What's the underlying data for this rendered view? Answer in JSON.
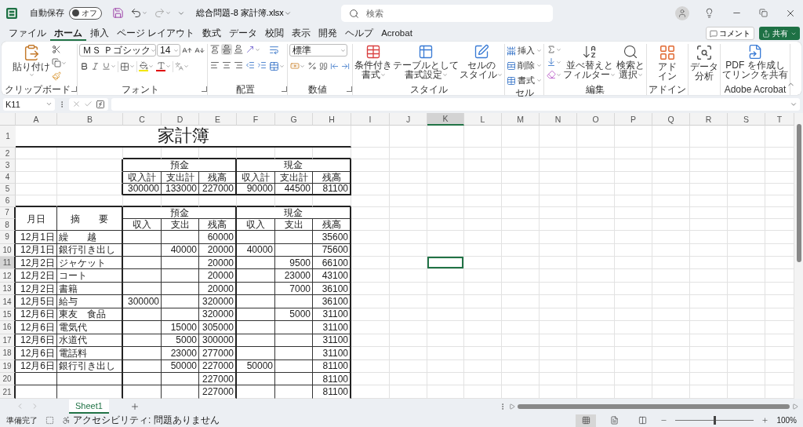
{
  "title_bar": {
    "autosave": {
      "label": "自動保存",
      "on": false,
      "state": "オフ"
    },
    "file_name": "総合問題-8 家計簿.xlsx",
    "search": {
      "placeholder": "検索"
    }
  },
  "menu": {
    "tabs": [
      {
        "label": "ファイル",
        "selected": false
      },
      {
        "label": "ホーム",
        "selected": true
      },
      {
        "label": "挿入",
        "selected": false
      },
      {
        "label": "ページ レイアウト",
        "selected": false
      },
      {
        "label": "数式",
        "selected": false
      },
      {
        "label": "データ",
        "selected": false
      },
      {
        "label": "校閲",
        "selected": false
      },
      {
        "label": "表示",
        "selected": false
      },
      {
        "label": "開発",
        "selected": false
      },
      {
        "label": "ヘルプ",
        "selected": false
      },
      {
        "label": "Acrobat",
        "selected": false
      }
    ],
    "comment_button": "コメント",
    "share_button": "共有"
  },
  "ribbon": {
    "groups": [
      {
        "kind": "clipboard",
        "label": "クリップボード",
        "buttons": [
          {
            "lines": [
              "貼り付け"
            ]
          }
        ]
      },
      {
        "kind": "font",
        "label": "フォント",
        "font_name": "ＭＳ Ｐゴシック",
        "font_size": "14"
      },
      {
        "kind": "alignment",
        "label": "配置",
        "vertical": [
          {
            "selected": false
          },
          {
            "selected": true
          },
          {
            "selected": false
          }
        ]
      },
      {
        "kind": "number",
        "label": "数値",
        "format": "標準"
      },
      {
        "kind": "styles",
        "label": "スタイル",
        "buttons": [
          {
            "lines": [
              "条件付き",
              "書式"
            ]
          },
          {
            "lines": [
              "テーブルとして",
              "書式設定"
            ]
          },
          {
            "lines": [
              "セルの",
              "スタイル"
            ]
          }
        ]
      },
      {
        "kind": "cells",
        "label": "セル",
        "buttons": [
          {
            "lines": [
              "挿入"
            ]
          },
          {
            "lines": [
              "削除"
            ]
          },
          {
            "lines": [
              "書式"
            ]
          }
        ]
      },
      {
        "kind": "editing",
        "label": "編集",
        "buttons": [
          {
            "lines": [
              "並べ替えと",
              "フィルター"
            ]
          },
          {
            "lines": [
              "検索と",
              "選択"
            ]
          }
        ]
      },
      {
        "kind": "addins",
        "label": "アドイン",
        "buttons": [
          {
            "lines": [
              "アド",
              "イン"
            ]
          }
        ]
      },
      {
        "kind": "analysis",
        "buttons": [
          {
            "lines": [
              "データ",
              "分析"
            ]
          }
        ]
      },
      {
        "kind": "acrobat",
        "label": "Adobe Acrobat",
        "buttons": [
          {
            "lines": [
              "PDF を作成し",
              "てリンクを共有"
            ]
          }
        ]
      }
    ]
  },
  "formula_bar": {
    "name_box": "K11"
  },
  "sheet": {
    "columns": [
      {
        "label": "A",
        "selected": false
      },
      {
        "label": "B",
        "selected": false
      },
      {
        "label": "C",
        "selected": false
      },
      {
        "label": "D",
        "selected": false
      },
      {
        "label": "E",
        "selected": false
      },
      {
        "label": "F",
        "selected": false
      },
      {
        "label": "G",
        "selected": false
      },
      {
        "label": "H",
        "selected": false
      },
      {
        "label": "I",
        "selected": false
      },
      {
        "label": "J",
        "selected": false
      },
      {
        "label": "K",
        "selected": true
      },
      {
        "label": "L",
        "selected": false
      },
      {
        "label": "M",
        "selected": false
      },
      {
        "label": "N",
        "selected": false
      },
      {
        "label": "O",
        "selected": false
      },
      {
        "label": "P",
        "selected": false
      },
      {
        "label": "Q",
        "selected": false
      },
      {
        "label": "R",
        "selected": false
      },
      {
        "label": "S",
        "selected": false
      },
      {
        "label": "T",
        "selected": false
      }
    ],
    "rows": [
      {
        "label": "1",
        "selected": false
      },
      {
        "label": "2",
        "selected": false
      },
      {
        "label": "3",
        "selected": false
      },
      {
        "label": "4",
        "selected": false
      },
      {
        "label": "5",
        "selected": false
      },
      {
        "label": "6",
        "selected": false
      },
      {
        "label": "7",
        "selected": false
      },
      {
        "label": "8",
        "selected": false
      },
      {
        "label": "9",
        "selected": false
      },
      {
        "label": "10",
        "selected": false
      },
      {
        "label": "11",
        "selected": true
      },
      {
        "label": "12",
        "selected": false
      },
      {
        "label": "13",
        "selected": false
      },
      {
        "label": "14",
        "selected": false
      },
      {
        "label": "15",
        "selected": false
      },
      {
        "label": "16",
        "selected": false
      },
      {
        "label": "17",
        "selected": false
      },
      {
        "label": "18",
        "selected": false
      },
      {
        "label": "19",
        "selected": false
      },
      {
        "label": "20",
        "selected": false
      },
      {
        "label": "21",
        "selected": false
      }
    ],
    "title": "家計簿",
    "summary": {
      "groups": [
        "預金",
        "現金"
      ],
      "headers": [
        "収入計",
        "支出計",
        "残高",
        "収入計",
        "支出計",
        "残高"
      ],
      "values": [
        "300000",
        "133000",
        "227000",
        "90000",
        "44500",
        "81100"
      ]
    },
    "ledger": {
      "date_header": "月日",
      "description_header": "摘　　要",
      "groups": [
        "預金",
        "現金"
      ],
      "headers": [
        "収入",
        "支出",
        "残高",
        "収入",
        "支出",
        "残高"
      ],
      "entries": [
        {
          "date": "12月1日",
          "description": "繰　　越",
          "amounts": {
            "deposit_balance": "60000",
            "cash_balance": "35600"
          }
        },
        {
          "date": "12月1日",
          "description": "銀行引き出し",
          "amounts": {
            "deposit_out": "40000",
            "deposit_balance": "20000",
            "cash_in": "40000",
            "cash_balance": "75600"
          }
        },
        {
          "date": "12月2日",
          "description": "ジャケット",
          "amounts": {
            "deposit_balance": "20000",
            "cash_out": "9500",
            "cash_balance": "66100"
          }
        },
        {
          "date": "12月2日",
          "description": "コート",
          "amounts": {
            "deposit_balance": "20000",
            "cash_out": "23000",
            "cash_balance": "43100"
          }
        },
        {
          "date": "12月2日",
          "description": "書籍",
          "amounts": {
            "deposit_balance": "20000",
            "cash_out": "7000",
            "cash_balance": "36100"
          }
        },
        {
          "date": "12月5日",
          "description": "給与",
          "amounts": {
            "deposit_in": "300000",
            "deposit_balance": "320000",
            "cash_balance": "36100"
          }
        },
        {
          "date": "12月6日",
          "description": "東友　食品",
          "amounts": {
            "deposit_balance": "320000",
            "cash_out": "5000",
            "cash_balance": "31100"
          }
        },
        {
          "date": "12月6日",
          "description": "電気代",
          "amounts": {
            "deposit_out": "15000",
            "deposit_balance": "305000",
            "cash_balance": "31100"
          }
        },
        {
          "date": "12月6日",
          "description": "水道代",
          "amounts": {
            "deposit_out": "5000",
            "deposit_balance": "300000",
            "cash_balance": "31100"
          }
        },
        {
          "date": "12月6日",
          "description": "電話料",
          "amounts": {
            "deposit_out": "23000",
            "deposit_balance": "277000",
            "cash_balance": "31100"
          }
        },
        {
          "date": "12月6日",
          "description": "銀行引き出し",
          "amounts": {
            "deposit_out": "50000",
            "deposit_balance": "227000",
            "cash_in": "50000",
            "cash_balance": "81100"
          }
        },
        {
          "amounts": {
            "deposit_balance": "227000",
            "cash_balance": "81100"
          }
        },
        {
          "amounts": {
            "deposit_balance": "227000",
            "cash_balance": "81100"
          }
        }
      ]
    }
  },
  "sheet_tabs": [
    {
      "label": "Sheet1",
      "selected": true
    }
  ],
  "status_bar": {
    "status": "準備完了",
    "accessibility": "アクセシビリティ: 問題ありません",
    "views": [
      {
        "selected": true
      },
      {
        "selected": false
      },
      {
        "selected": false
      }
    ],
    "zoom": {
      "level": 0.5,
      "reading": "100%"
    }
  }
}
